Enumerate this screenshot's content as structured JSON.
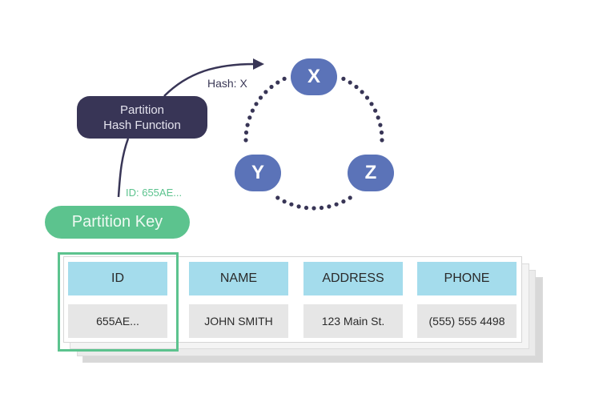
{
  "diagram": {
    "hash_function": {
      "line1": "Partition",
      "line2": "Hash Function"
    },
    "hash_output_label": "Hash: X",
    "id_label": "ID: 655AE...",
    "partition_key_label": "Partition Key",
    "nodes": [
      {
        "id": "x",
        "label": "X"
      },
      {
        "id": "y",
        "label": "Y"
      },
      {
        "id": "z",
        "label": "Z"
      }
    ],
    "table": {
      "headers": [
        "ID",
        "NAME",
        "ADDRESS",
        "PHONE"
      ],
      "row": [
        "655AE...",
        "JOHN SMITH",
        "123 Main St.",
        "(555) 555 4498"
      ],
      "highlighted_column": "ID"
    },
    "colors": {
      "hash_box": "#383556",
      "partition_key": "#5cc38e",
      "node": "#5b73b8",
      "header_cell": "#a4dcec",
      "value_cell": "#e6e6e6",
      "ring_dots": "#383556"
    }
  }
}
